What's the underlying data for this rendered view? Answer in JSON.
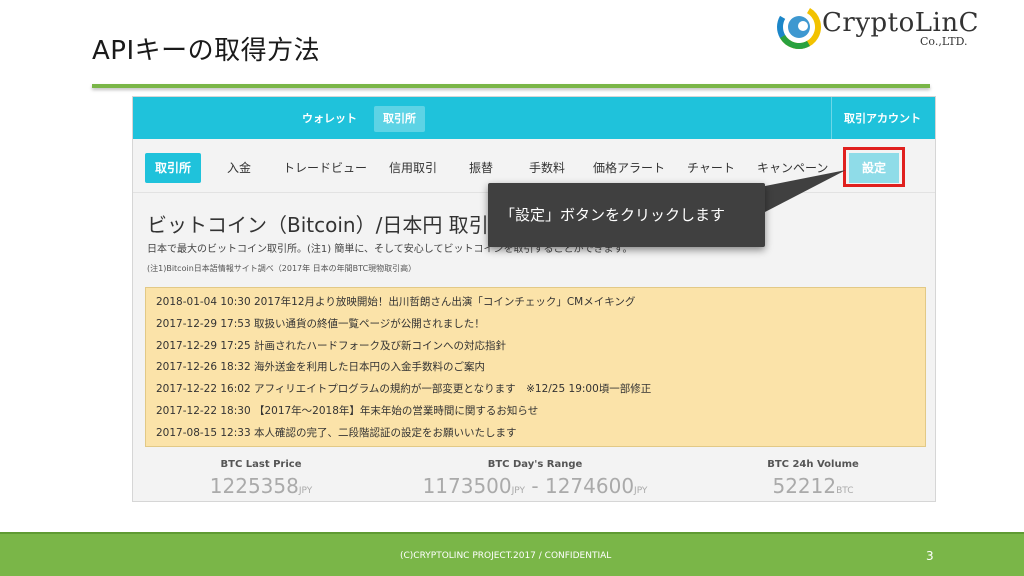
{
  "slide": {
    "title": "APIキーの取得方法",
    "page_number": "3",
    "footer": "(C)CRYPTOLINC PROJECT.2017 / CONFIDENTIAL",
    "accent_color": "#7ab648"
  },
  "logo": {
    "name": "CryptoLinC",
    "sub": "Co.,LTD."
  },
  "screenshot": {
    "topnav": {
      "items": [
        "ウォレット",
        "取引所"
      ],
      "active": "取引所",
      "account": "取引アカウント",
      "color": "#1fc2db"
    },
    "subnav": {
      "items": [
        "取引所",
        "入金",
        "トレードビュー",
        "信用取引",
        "振替",
        "手数料",
        "価格アラート",
        "チャート",
        "キャンペーン",
        "設定"
      ],
      "active": "取引所",
      "highlighted": "設定"
    },
    "page_title": "ビットコイン（Bitcoin）/日本円 取引所",
    "page_desc": "日本で最大のビットコイン取引所。(注1) 簡単に、そして安心してビットコインを取引することができます。",
    "page_note": "(注1)Bitcoin日本語情報サイト調べ（2017年 日本の年間BTC現物取引高）",
    "news": [
      "2018-01-04 10:30 2017年12月より放映開始！出川哲朗さん出演「コインチェック」CMメイキング",
      "2017-12-29 17:53 取扱い通貨の終値一覧ページが公開されました！",
      "2017-12-29 17:25 計画されたハードフォーク及び新コインへの対応指針",
      "2017-12-26 18:32 海外送金を利用した日本円の入金手数料のご案内",
      "2017-12-22 16:02 アフィリエイトプログラムの規約が一部変更となります　※12/25 19:00頃一部修正",
      "2017-12-22 18:30 【2017年〜2018年】年末年始の営業時間に関するお知らせ",
      "2017-08-15 12:33 本人確認の完了、二段階認証の設定をお願いいたします"
    ],
    "stats": [
      {
        "label": "BTC Last Price",
        "value": "1225358",
        "unit": "JPY"
      },
      {
        "label": "BTC Day's Range",
        "value": "1173500",
        "unit": "JPY",
        "value2": "1274600",
        "unit2": "JPY"
      },
      {
        "label": "BTC 24h Volume",
        "value": "52212",
        "unit": "BTC"
      }
    ]
  },
  "callout": {
    "text": "「設定」ボタンをクリックします"
  }
}
